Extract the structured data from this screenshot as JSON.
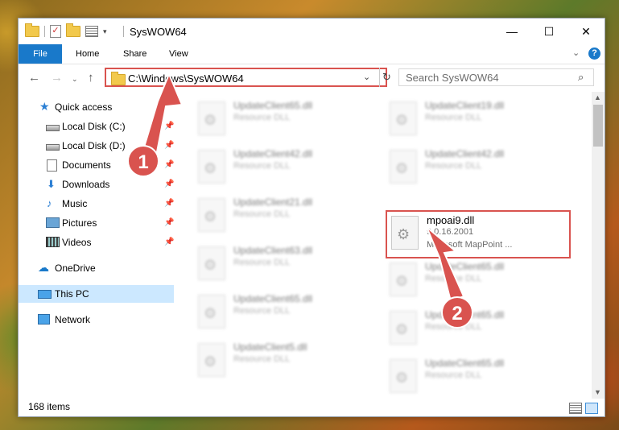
{
  "window": {
    "title": "SysWOW64",
    "minimize_glyph": "—",
    "maximize_glyph": "☐",
    "close_glyph": "✕"
  },
  "ribbon": {
    "file_tab": "File",
    "tabs": [
      "Home",
      "Share",
      "View"
    ]
  },
  "address": {
    "path": "C:\\Windows\\SysWOW64",
    "search_placeholder": "Search SysWOW64"
  },
  "sidebar": {
    "items": [
      {
        "label": "Quick access",
        "icon": "star-icon"
      },
      {
        "label": "Local Disk (C:)",
        "icon": "disk-icon"
      },
      {
        "label": "Local Disk (D:)",
        "icon": "disk-icon"
      },
      {
        "label": "Documents",
        "icon": "documents-icon"
      },
      {
        "label": "Downloads",
        "icon": "download-icon"
      },
      {
        "label": "Music",
        "icon": "music-icon"
      },
      {
        "label": "Pictures",
        "icon": "pictures-icon"
      },
      {
        "label": "Videos",
        "icon": "videos-icon"
      },
      {
        "label": "OneDrive",
        "icon": "cloud-icon"
      },
      {
        "label": "This PC",
        "icon": "computer-icon"
      },
      {
        "label": "Network",
        "icon": "network-icon"
      }
    ]
  },
  "files": [
    {
      "name": "UpdateClient65.dll",
      "sub": "Resource DLL"
    },
    {
      "name": "UpdateClient19.dll",
      "sub": "Resource DLL"
    },
    {
      "name": "UpdateClient42.dll",
      "sub": "Resource DLL"
    },
    {
      "name": "UpdateClient42.dll",
      "sub": "Resource DLL"
    },
    {
      "name": "UpdateClient21.dll",
      "sub": "Resource DLL"
    },
    {
      "name": "mpoai9.dll",
      "sub": "9.0.16.2001",
      "sub2": "Microsoft MapPoint ..."
    },
    {
      "name": "UpdateClient63.dll",
      "sub": "Resource DLL"
    },
    {
      "name": "UpdateClient65.dll",
      "sub": "Resource DLL"
    },
    {
      "name": "UpdateClient65.dll",
      "sub": "Resource DLL"
    },
    {
      "name": "UpdateClient65.dll",
      "sub": "Resource DLL"
    },
    {
      "name": "UpdateClient5.dll",
      "sub": "Resource DLL"
    },
    {
      "name": "UpdateClient65.dll",
      "sub": "Resource DLL"
    }
  ],
  "status": {
    "item_count": "168 items"
  },
  "callouts": {
    "one": "1",
    "two": "2"
  },
  "colors": {
    "accent": "#1979ca",
    "highlight": "#d9534f",
    "selection": "#cce8ff"
  }
}
